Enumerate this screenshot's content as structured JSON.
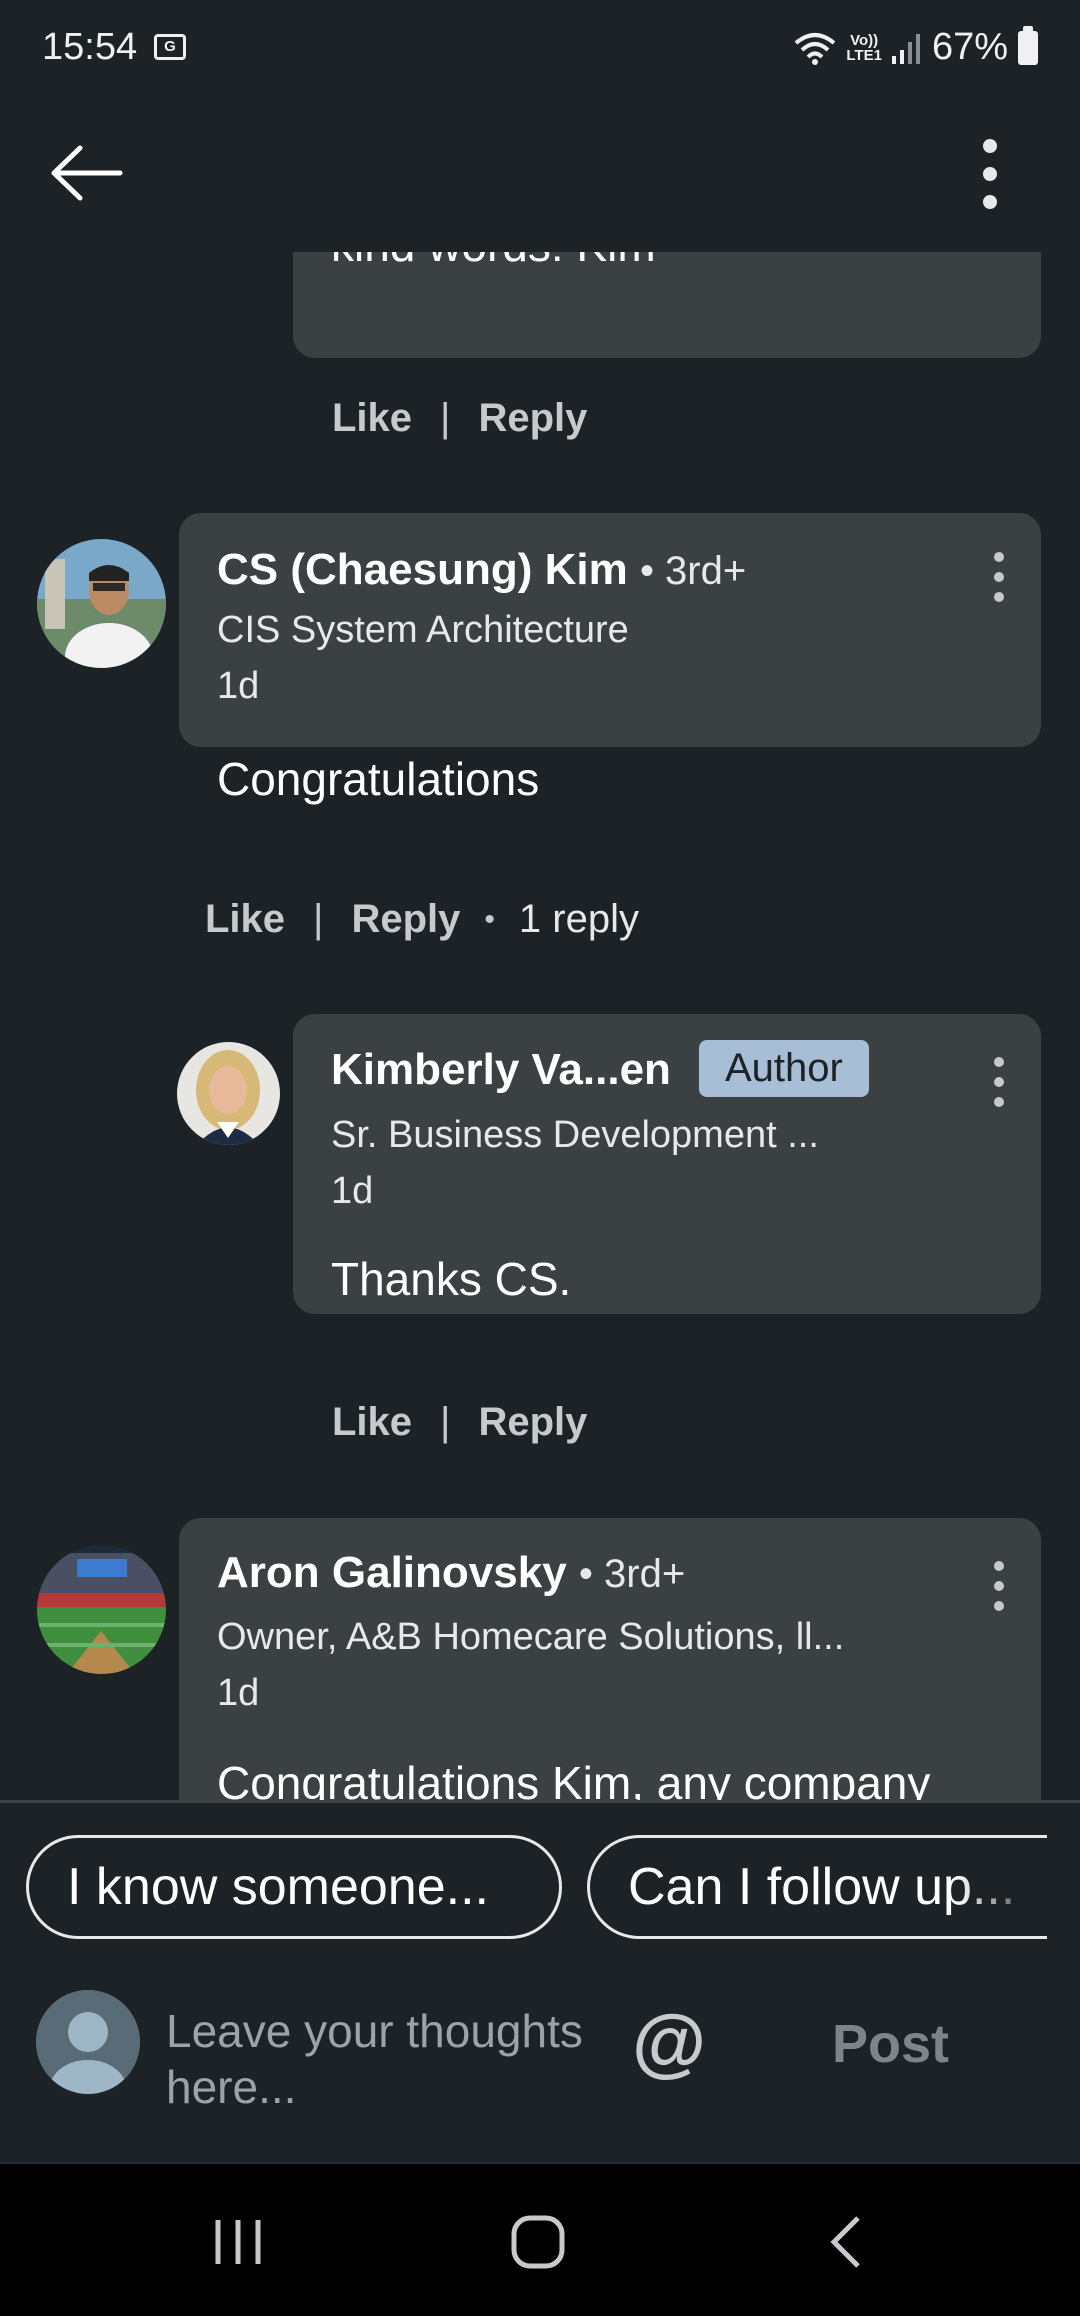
{
  "status_bar": {
    "time": "15:54",
    "sim_icon": "G",
    "volte_label": "Vo))\nLTE1",
    "battery_text": "67%"
  },
  "app_bar": {
    "back_icon": "arrow-left-icon",
    "menu_icon": "more-vertical-icon"
  },
  "comments": {
    "prev_reply": {
      "text": "kind words!  Kim",
      "like": "Like",
      "reply": "Reply"
    },
    "cs_kim": {
      "name": "CS (Chaesung) Kim",
      "degree": "• 3rd+",
      "headline": "CIS System Architecture",
      "time": "1d",
      "text": "Congratulations",
      "like": "Like",
      "reply": "Reply",
      "reply_count": "1 reply"
    },
    "kimberly": {
      "name": "Kimberly Va...en",
      "badge": "Author",
      "headline": "Sr. Business Development ...",
      "time": "1d",
      "text": "Thanks CS.",
      "like": "Like",
      "reply": "Reply"
    },
    "aron": {
      "name": "Aron Galinovsky",
      "degree": "• 3rd+",
      "headline": "Owner, A&B Homecare Solutions, ll...",
      "time": "1d",
      "text": "Congratulations Kim, any company"
    }
  },
  "composer": {
    "chips": [
      "I know someone...",
      "Can I follow up..."
    ],
    "placeholder": "Leave your thoughts here...",
    "mention": "@",
    "post": "Post"
  },
  "colors": {
    "background": "#1d2226",
    "bubble": "#3b4043",
    "badge": "#a8bed6"
  }
}
